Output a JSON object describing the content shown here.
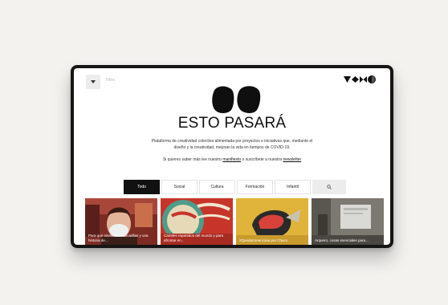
{
  "header": {
    "filter_label": "Filtro",
    "menu_icon": "chevron-down-icon",
    "brand_icons": [
      "triangle-mark-icon",
      "diamond-mark-icon",
      "bowtie-mark-icon",
      "circle-mark-icon"
    ]
  },
  "hero": {
    "title": "ESTO PASARÁ",
    "description": "Plataforma de creatividad colectiva alimentada por proyectos e iniciativas que, mediante el diseño y la creatividad, mejoran la vida en tiempos de COVID-19.",
    "subscribe_prefix": "Si quieres saber más lee nuestro",
    "manifesto_link": "manifiesto",
    "subscribe_middle": "o suscríbete a nuestra",
    "newsletter_link": "newsletter"
  },
  "tabs": [
    {
      "label": "Todo",
      "active": true
    },
    {
      "label": "Social",
      "active": false
    },
    {
      "label": "Cultura",
      "active": false
    },
    {
      "label": "Formación",
      "active": false
    },
    {
      "label": "Infantil",
      "active": false
    }
  ],
  "search_icon": "search-icon",
  "cards": [
    {
      "title": "Para qué sirven las mascarillas y una historia de..."
    },
    {
      "title": "Carteles repartidos del mundo y para afrontar en..."
    },
    {
      "title": "#Quedarmeencasa por Chacs"
    },
    {
      "title": "Arquero, cosas esenciales para..."
    }
  ],
  "colors": {
    "active_tab": "#111111",
    "device_frame": "#151515",
    "background": "#f3f2ef"
  }
}
